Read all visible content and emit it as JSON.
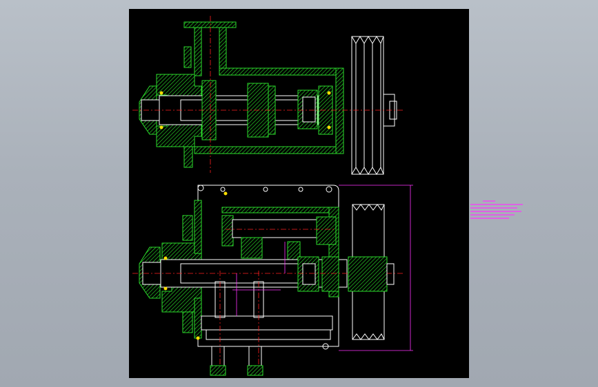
{
  "drawing": {
    "background_color": "#000000",
    "viewport_color": "#aab1ba",
    "colors": {
      "section_hatch": "#2bdc2b",
      "outline": "#ffffff",
      "centerline": "#ff2020",
      "dimension": "#ff33ff",
      "bolt_marker": "#ffe000"
    },
    "views": [
      "top-view",
      "front-section-view"
    ],
    "technical_notes": "",
    "dimensions": []
  }
}
